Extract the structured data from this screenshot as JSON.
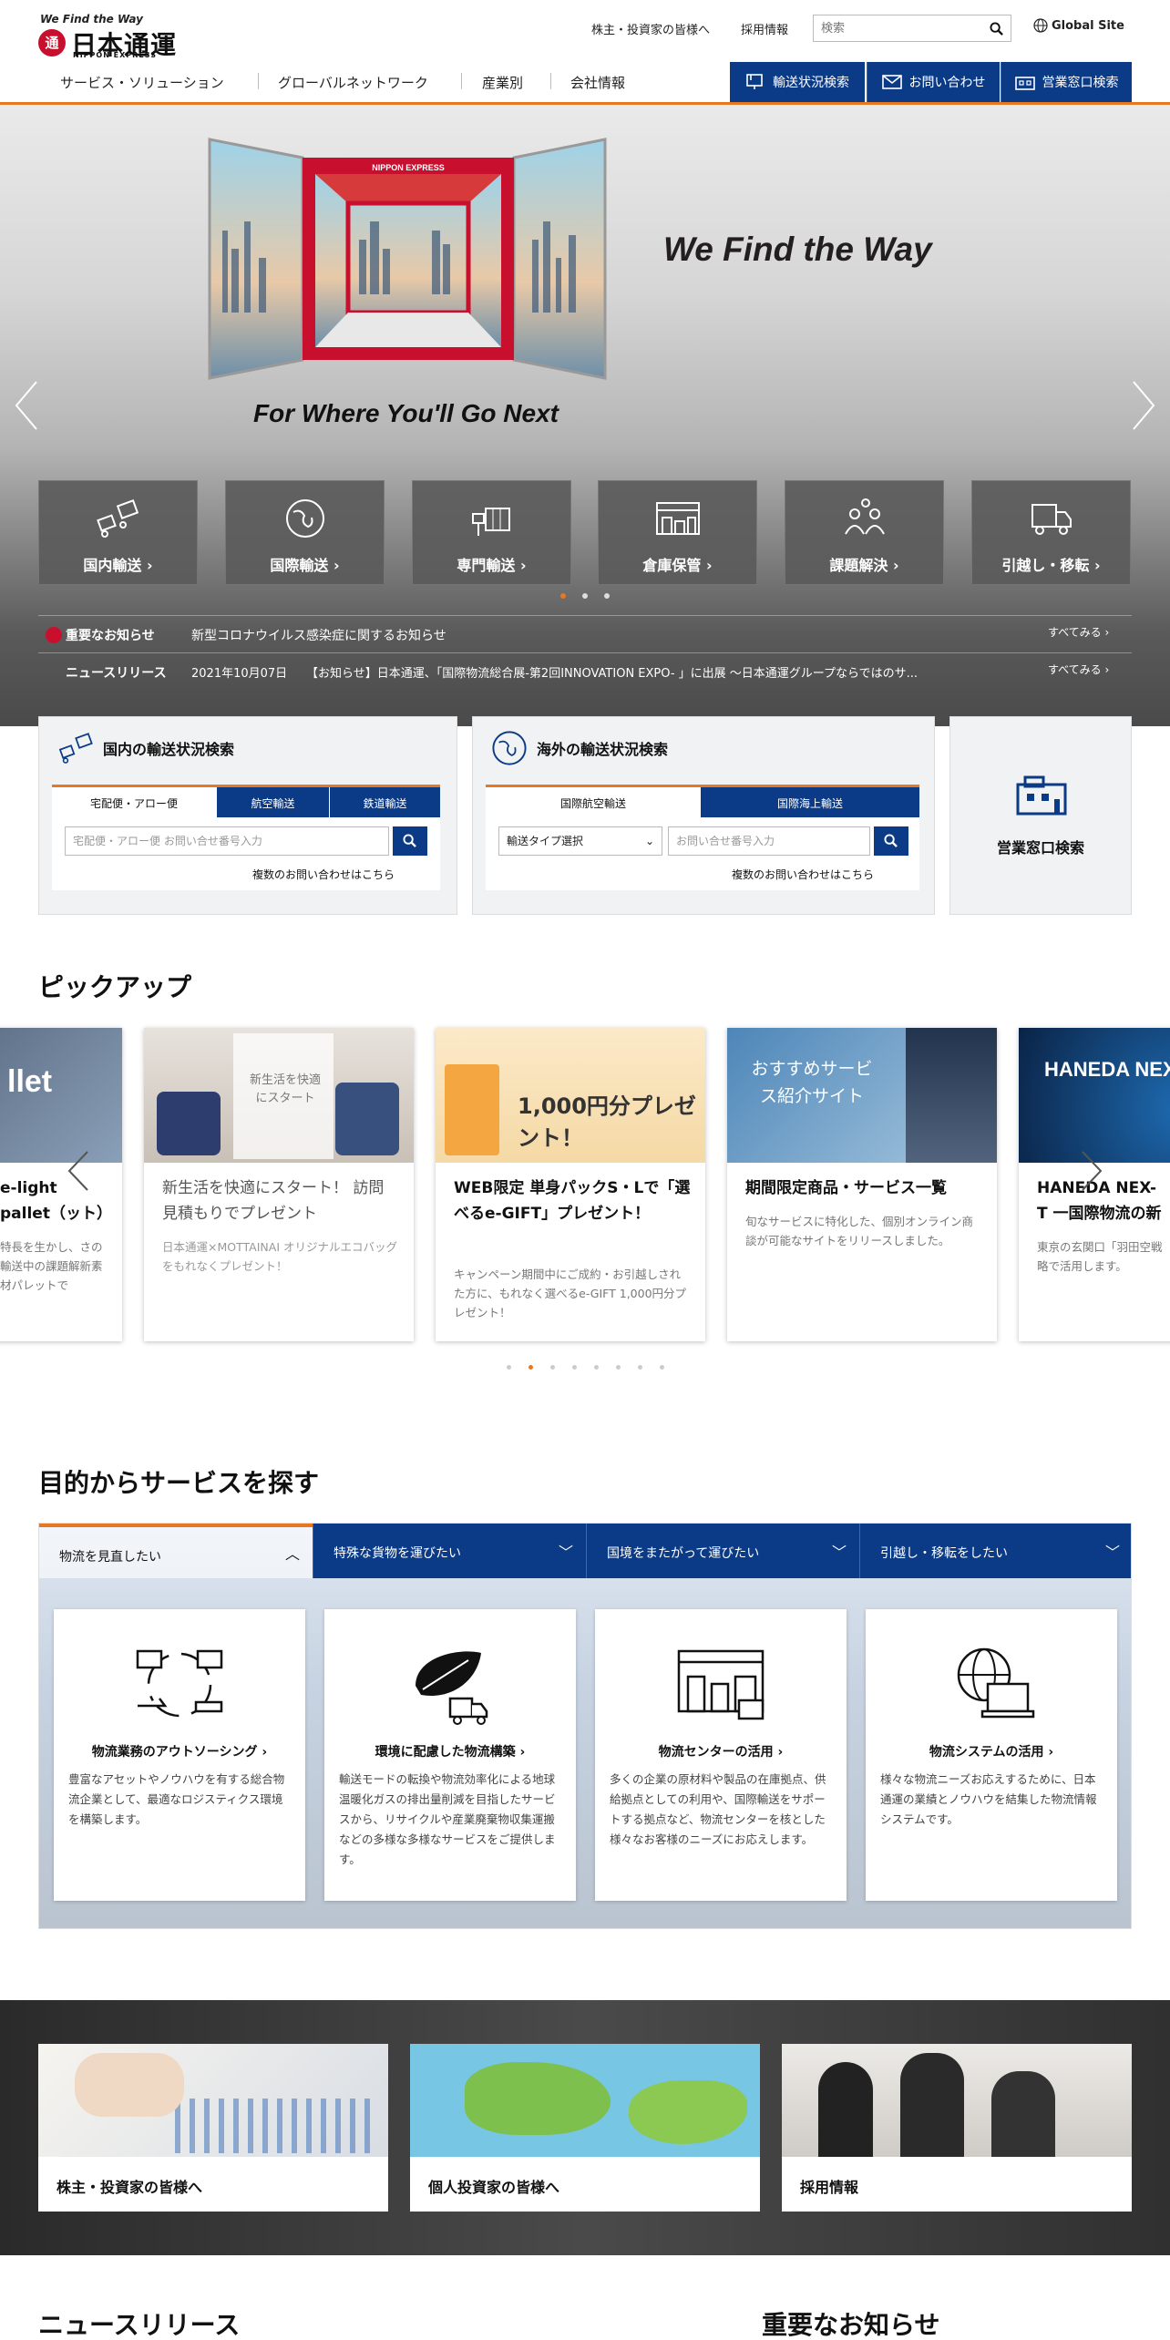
{
  "brand": {
    "tagline": "We Find the Way",
    "name_jp": "日本通運",
    "name_en": "NIPPON EXPRESS",
    "mark": "通"
  },
  "utility": {
    "investors": "株主・投資家の皆様へ",
    "recruit": "採用情報",
    "search_placeholder": "検索",
    "global": "Global Site"
  },
  "nav": {
    "items": [
      "サービス・ソリューション",
      "グローバルネットワーク",
      "産業別",
      "会社情報"
    ]
  },
  "quick": {
    "tracking": "輸送状況検索",
    "contact": "お問い合わせ",
    "office": "営業窓口検索"
  },
  "hero": {
    "headline": "We Find the Way",
    "sub": "For Where You'll Go Next",
    "container_label": "NIPPON EXPRESS"
  },
  "services": [
    "国内輸送",
    "国際輸送",
    "専門輸送",
    "倉庫保管",
    "課題解決",
    "引越し・移転"
  ],
  "notice": {
    "important_label": "重要なお知らせ",
    "important_text": "新型コロナウイルス感染症に関するお知らせ",
    "news_label": "ニュースリリース",
    "news_date": "2021年10月07日",
    "news_text": "【お知らせ】日本通運、「国際物流総合展-第2回INNOVATION EXPO- 」に出展 ～日本通運グループならではのサ...",
    "see_all": "すべてみる"
  },
  "domestic": {
    "title": "国内の輸送状況検索",
    "tabs": [
      "宅配便・アロー便",
      "航空輸送",
      "鉄道輸送"
    ],
    "placeholder": "宅配便・アロー便 お問い合せ番号入力",
    "multi": "複数のお問い合わせはこちら"
  },
  "overseas": {
    "title": "海外の輸送状況検索",
    "tabs": [
      "国際航空輸送",
      "国際海上輸送"
    ],
    "select": "輸送タイプ選択",
    "placeholder": "お問い合せ番号入力",
    "multi": "複数のお問い合わせはこちら"
  },
  "office": {
    "label": "営業窓口検索"
  },
  "pickup": {
    "title": "ピックアップ",
    "cards": [
      {
        "title": "e-light pallet（ット）",
        "desc": "特長を生かし、さの輸送中の課題解新素材パレットで"
      },
      {
        "title": "新生活を快適にスタート！ 訪問見積もりでプレゼント",
        "desc": "日本通運×MOTTAINAI オリジナルエコバッグをもれなくプレゼント！",
        "img_text": "新生活を快適にスタート"
      },
      {
        "title": "WEB限定 単身パックS・Lで「選べるe-GIFT」プレゼント！",
        "desc": "キャンペーン期間中にご成約・お引越しされた方に、もれなく選べるe-GIFT 1,000円分プレゼント！",
        "img_text": "1,000円分プレゼント！"
      },
      {
        "title": "期間限定商品・サービス一覧",
        "desc": "旬なサービスに特化した、個別オンライン商談が可能なサイトをリリースしました。",
        "img_text": "おすすめサービス紹介サイト"
      },
      {
        "title": "HANEDA NEX-T 一国際物流の新",
        "desc": "東京の玄関口「羽田空戦略で活用します。",
        "img_text": "HANEDA NEX"
      }
    ]
  },
  "purpose": {
    "title": "目的からサービスを探す",
    "tabs": [
      "物流を見直したい",
      "特殊な貨物を運びたい",
      "国境をまたがって運びたい",
      "引越し・移転をしたい"
    ],
    "cards": [
      {
        "title": "物流業務のアウトソーシング",
        "desc": "豊富なアセットやノウハウを有する総合物流企業として、最適なロジスティクス環境を構築します。"
      },
      {
        "title": "環境に配慮した物流構築",
        "desc": "輸送モードの転換や物流効率化による地球温暖化ガスの排出量削減を目指したサービスから、リサイクルや産業廃棄物収集運搬などの多様な多様なサービスをご提供します。"
      },
      {
        "title": "物流センターの活用",
        "desc": "多くの企業の原材料や製品の在庫拠点、供給拠点としての利用や、国際輸送をサポートする拠点など、物流センターを核とした様々なお客様のニーズにお応えします。"
      },
      {
        "title": "物流システムの活用",
        "desc": "様々な物流ニーズお応えするために、日本通運の業績とノウハウを結集した物流情報システムです。"
      }
    ]
  },
  "investor": {
    "cards": [
      "株主・投資家の皆様へ",
      "個人投資家の皆様へ",
      "採用情報"
    ]
  },
  "bottom": {
    "news": "ニュースリリース",
    "important": "重要なお知らせ"
  },
  "colors": {
    "accent": "#e87722",
    "navy": "#0b3a86"
  }
}
